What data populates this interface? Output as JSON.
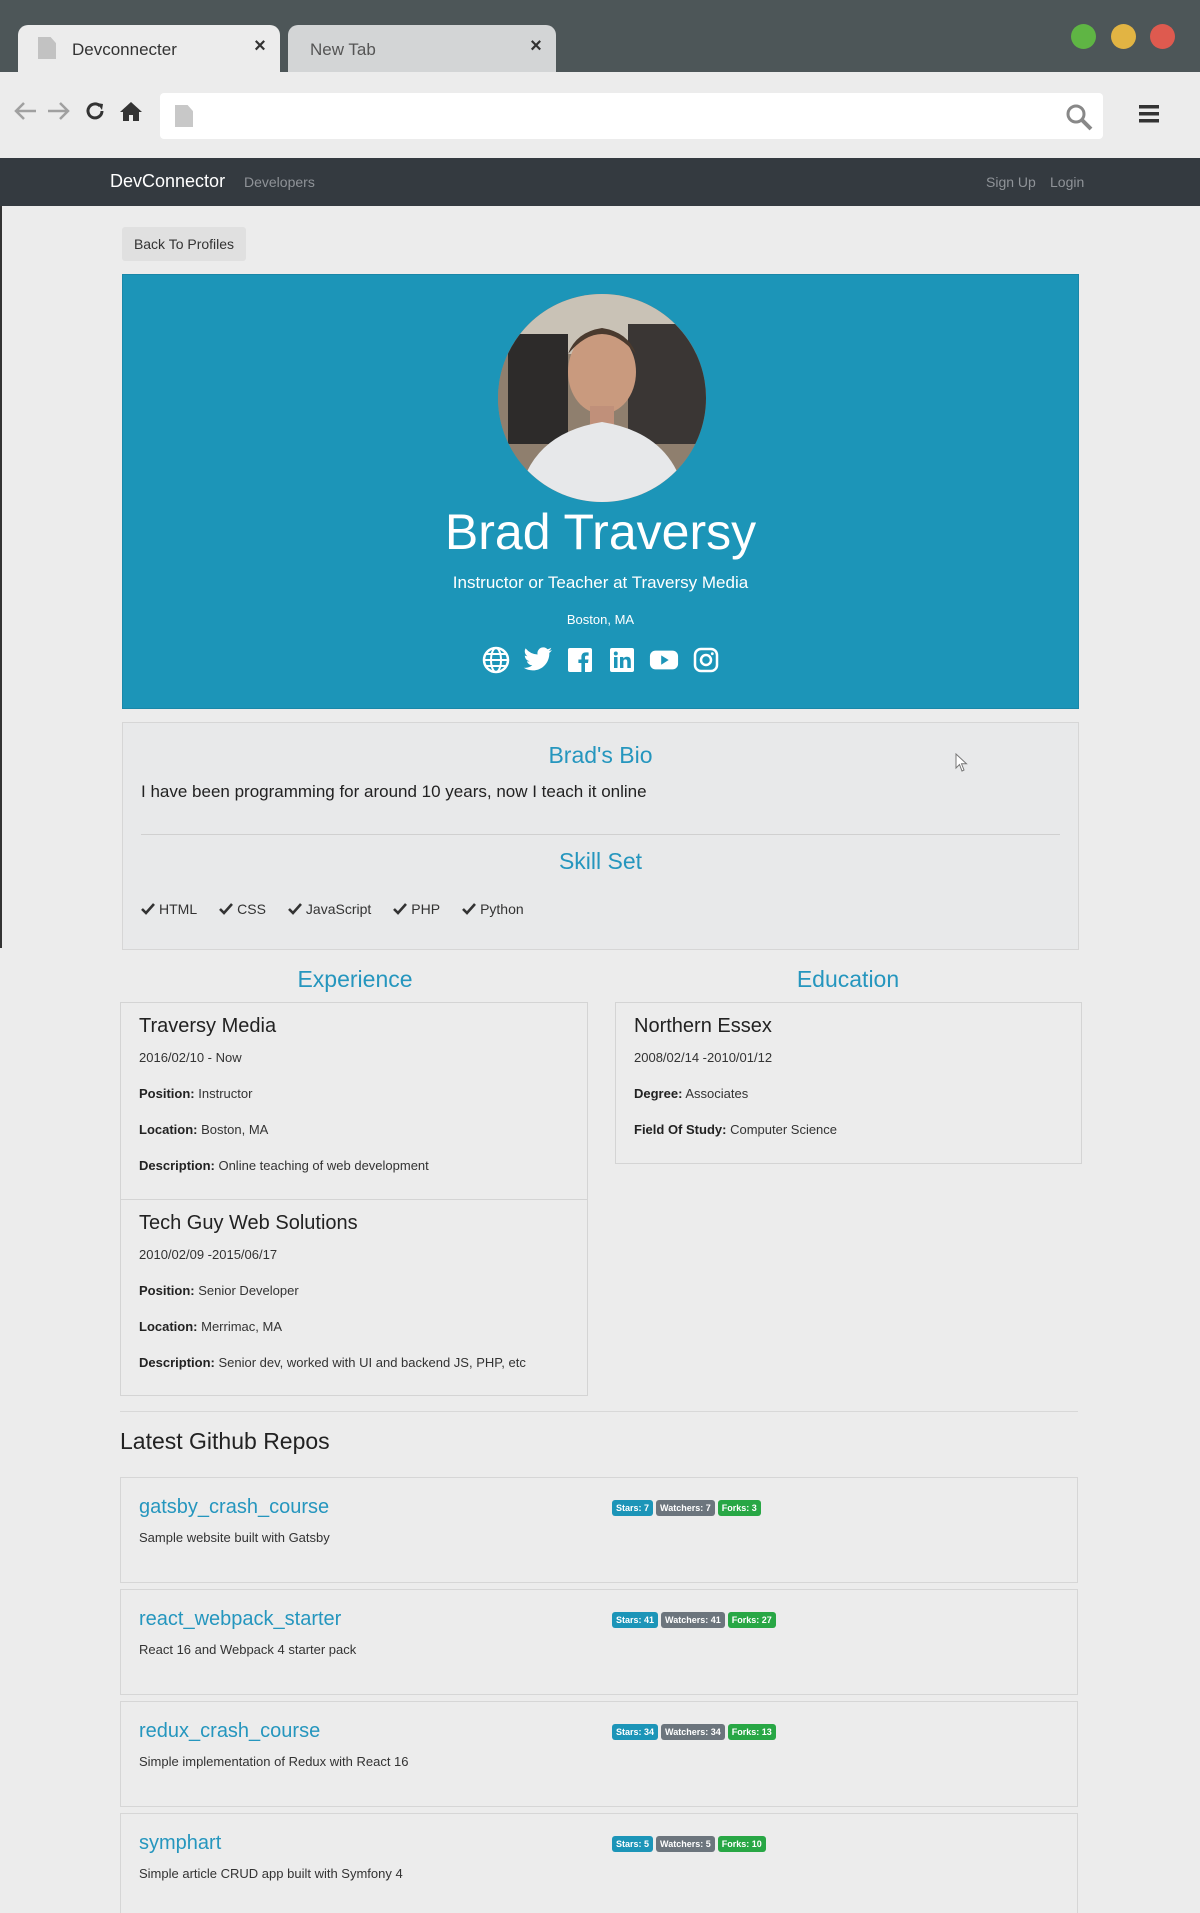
{
  "browser": {
    "tabs": [
      {
        "title": "Devconnecter",
        "active": true
      },
      {
        "title": "New Tab",
        "active": false
      }
    ],
    "address": {
      "value": "",
      "placeholder": ""
    }
  },
  "navbar": {
    "brand": "DevConnector",
    "links": {
      "developers": "Developers",
      "signup": "Sign Up",
      "login": "Login"
    }
  },
  "back_button": "Back To Profiles",
  "profile": {
    "name": "Brad Traversy",
    "title": "Instructor or Teacher at Traversy Media",
    "location": "Boston, MA",
    "socials": [
      "globe-icon",
      "twitter-icon",
      "facebook-icon",
      "linkedin-icon",
      "youtube-icon",
      "instagram-icon"
    ]
  },
  "bio": {
    "heading": "Brad's Bio",
    "text": "I have been programming for around 10 years, now I teach it online",
    "skills_heading": "Skill Set",
    "skills": [
      "HTML",
      "CSS",
      "JavaScript",
      "PHP",
      "Python"
    ]
  },
  "experience": {
    "heading": "Experience",
    "items": [
      {
        "org": "Traversy Media",
        "dates": "2016/02/10 - Now",
        "position_label": "Position:",
        "position": "Instructor",
        "location_label": "Location:",
        "location": "Boston, MA",
        "description_label": "Description:",
        "description": "Online teaching of web development"
      },
      {
        "org": "Tech Guy Web Solutions",
        "dates": "2010/02/09 -2015/06/17",
        "position_label": "Position:",
        "position": "Senior Developer",
        "location_label": "Location:",
        "location": "Merrimac, MA",
        "description_label": "Description:",
        "description": "Senior dev, worked with UI and backend JS, PHP, etc"
      }
    ]
  },
  "education": {
    "heading": "Education",
    "items": [
      {
        "school": "Northern Essex",
        "dates": "2008/02/14 -2010/01/12",
        "degree_label": "Degree:",
        "degree": "Associates",
        "field_label": "Field Of Study:",
        "field": "Computer Science"
      }
    ]
  },
  "repos": {
    "heading": "Latest Github Repos",
    "items": [
      {
        "name": "gatsby_crash_course",
        "description": "Sample website built with Gatsby",
        "stars": "Stars: 7",
        "watchers": "Watchers: 7",
        "forks": "Forks: 3"
      },
      {
        "name": "react_webpack_starter",
        "description": "React 16 and Webpack 4 starter pack",
        "stars": "Stars: 41",
        "watchers": "Watchers: 41",
        "forks": "Forks: 27"
      },
      {
        "name": "redux_crash_course",
        "description": "Simple implementation of Redux with React 16",
        "stars": "Stars: 34",
        "watchers": "Watchers: 34",
        "forks": "Forks: 13"
      },
      {
        "name": "symphart",
        "description": "Simple article CRUD app built with Symfony 4",
        "stars": "Stars: 5",
        "watchers": "Watchers: 5",
        "forks": "Forks: 10"
      }
    ]
  },
  "colors": {
    "primary": "#1c95b8",
    "navbar": "#343a40",
    "stars_badge": "#1c95b8",
    "watchers_badge": "#6c757d",
    "forks_badge": "#28a745"
  }
}
